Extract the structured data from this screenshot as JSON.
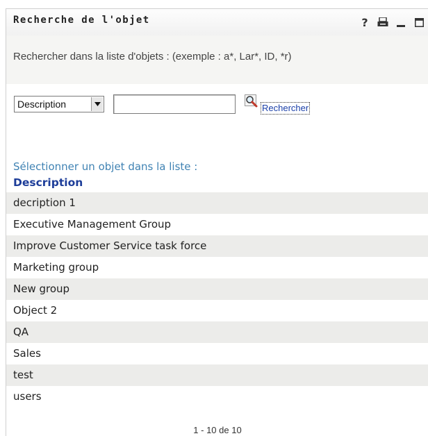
{
  "window": {
    "title": "Recherche de l'objet",
    "help_label": "?"
  },
  "instructions": "Rechercher dans la liste d'objets : (exemple : a*, Lar*, ID, *r)",
  "search": {
    "field_selected": "Description",
    "query_value": "",
    "button_label": "Rechercher"
  },
  "results": {
    "caption": "Sélectionner un objet dans la liste :",
    "column_header": "Description",
    "rows": [
      "decription 1",
      "Executive Management Group",
      "Improve Customer Service task force",
      "Marketing group",
      "New group",
      "Object 2",
      "QA",
      "Sales",
      "test",
      "users"
    ]
  },
  "pagination": "1 - 10 de 10",
  "colors": {
    "accent_link": "#1a3fa8",
    "caption_blue": "#3f82b3",
    "header_blue": "#1d3d99",
    "row_alt": "#ececea"
  }
}
